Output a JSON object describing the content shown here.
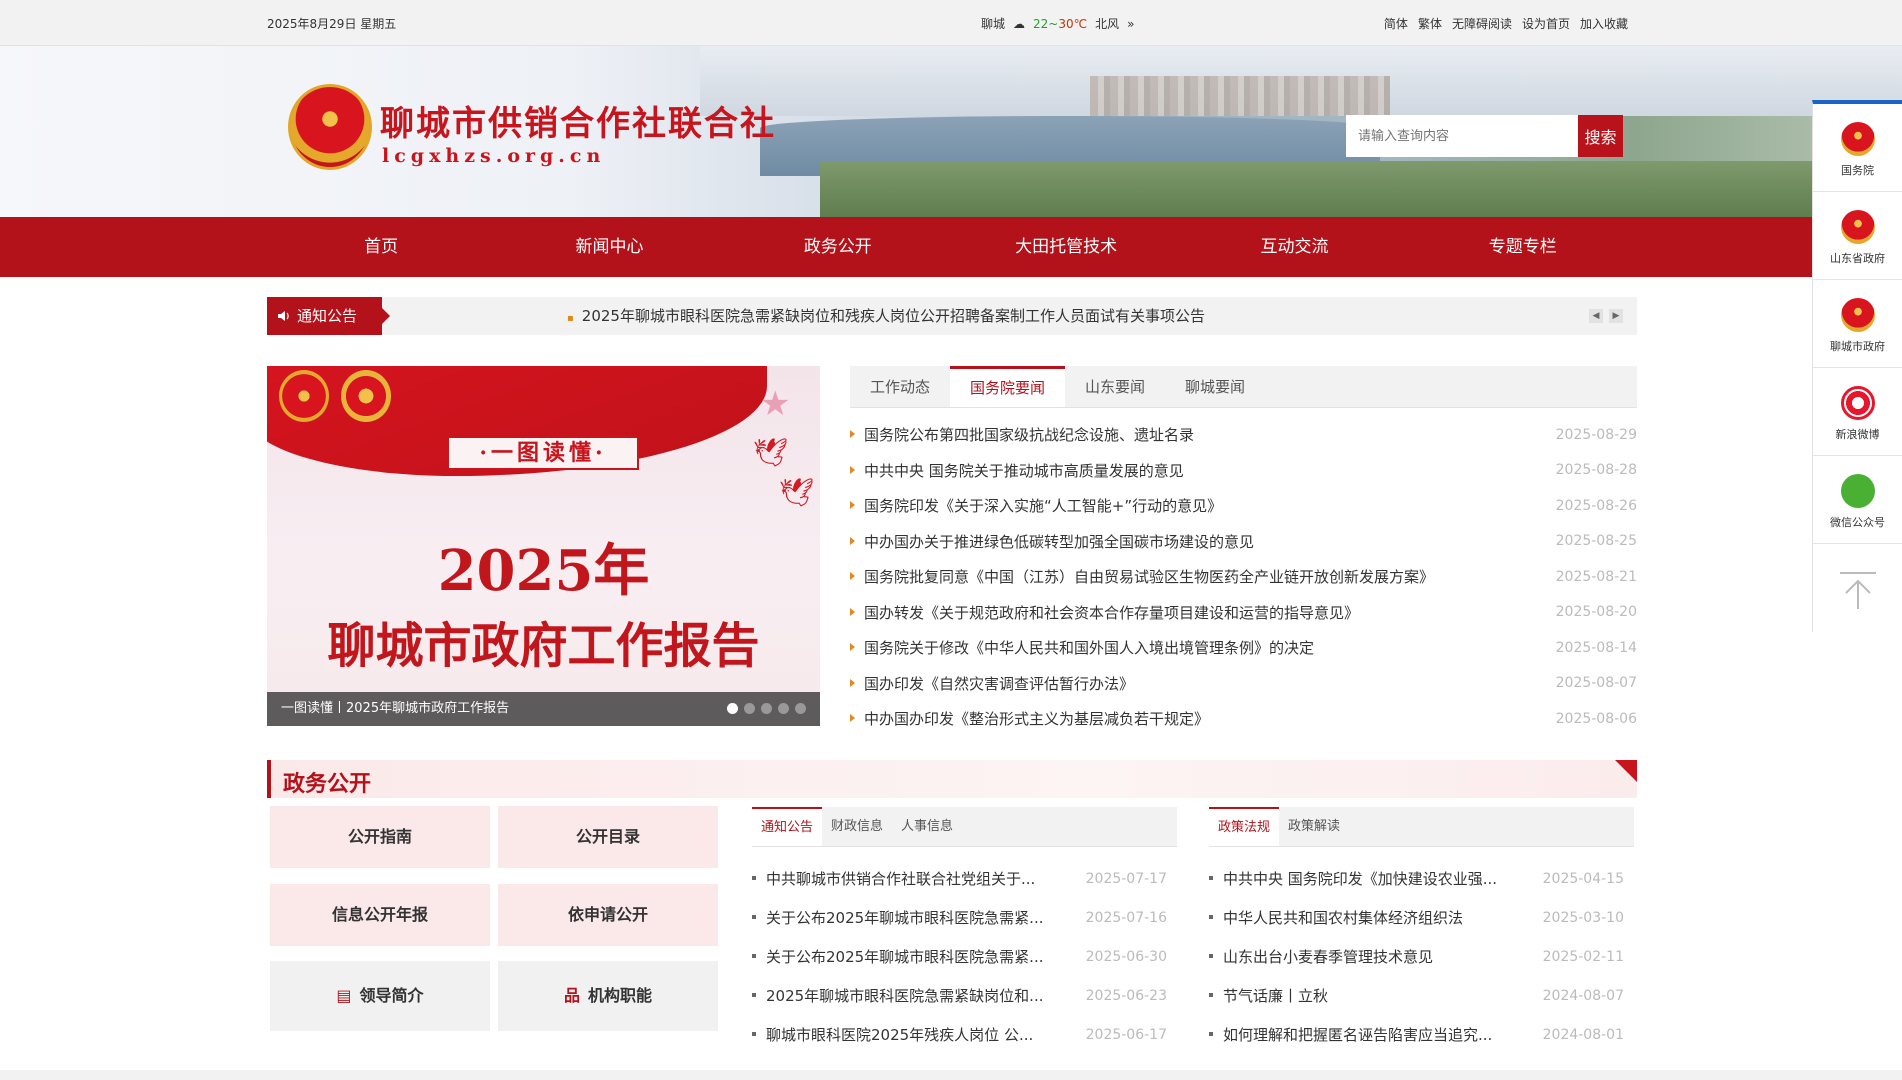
{
  "topbar": {
    "date": "2025年8月29日 星期五",
    "city": "聊城",
    "temp_low": "22",
    "temp_sep": "~",
    "temp_high": "30℃",
    "wind": "北风",
    "links": [
      "简体",
      "繁体",
      "无障碍阅读",
      "设为首页",
      "加入收藏"
    ]
  },
  "header": {
    "title": "聊城市供销合作社联合社",
    "domain": "lcgxhzs.org.cn",
    "search_placeholder": "请输入查询内容",
    "search_button": "搜索"
  },
  "nav": [
    "首页",
    "新闻中心",
    "政务公开",
    "大田托管技术",
    "互动交流",
    "专题专栏"
  ],
  "notice": {
    "label": "通知公告",
    "message": "2025年聊城市眼科医院急需紧缺岗位和残疾人岗位公开招聘备案制工作人员面试有关事项公告"
  },
  "slider": {
    "tag": "·一图读懂·",
    "year": "2025年",
    "title": "聊城市政府工作报告",
    "caption": "一图读懂丨2025年聊城市政府工作报告",
    "active_index": 0,
    "count": 5
  },
  "news": {
    "tabs": [
      "工作动态",
      "国务院要闻",
      "山东要闻",
      "聊城要闻"
    ],
    "active_tab": 1,
    "items": [
      {
        "title": "国务院公布第四批国家级抗战纪念设施、遗址名录",
        "date": "2025-08-29"
      },
      {
        "title": "中共中央 国务院关于推动城市高质量发展的意见",
        "date": "2025-08-28"
      },
      {
        "title": "国务院印发《关于深入实施“人工智能+”行动的意见》",
        "date": "2025-08-26"
      },
      {
        "title": "中办国办关于推进绿色低碳转型加强全国碳市场建设的意见",
        "date": "2025-08-25"
      },
      {
        "title": "国务院批复同意《中国（江苏）自由贸易试验区生物医药全产业链开放创新发展方案》",
        "date": "2025-08-21"
      },
      {
        "title": "国办转发《关于规范政府和社会资本合作存量项目建设和运营的指导意见》",
        "date": "2025-08-20"
      },
      {
        "title": "国务院关于修改《中华人民共和国外国人入境出境管理条例》的决定",
        "date": "2025-08-14"
      },
      {
        "title": "国办印发《自然灾害调查评估暂行办法》",
        "date": "2025-08-07"
      },
      {
        "title": "中办国办印发《整治形式主义为基层减负若干规定》",
        "date": "2025-08-06"
      }
    ]
  },
  "gov": {
    "heading": "政务公开",
    "buttons": [
      "公开指南",
      "公开目录",
      "信息公开年报",
      "依申请公开"
    ],
    "leader_button": "领导简介",
    "org_button": "机构职能",
    "box1": {
      "tabs": [
        "通知公告",
        "财政信息",
        "人事信息"
      ],
      "items": [
        {
          "title": "中共聊城市供销合作社联合社党组关于...",
          "date": "2025-07-17"
        },
        {
          "title": "关于公布2025年聊城市眼科医院急需紧...",
          "date": "2025-07-16"
        },
        {
          "title": "关于公布2025年聊城市眼科医院急需紧...",
          "date": "2025-06-30"
        },
        {
          "title": "2025年聊城市眼科医院急需紧缺岗位和...",
          "date": "2025-06-23"
        },
        {
          "title": "聊城市眼科医院2025年残疾人岗位 公...",
          "date": "2025-06-17"
        }
      ]
    },
    "box2": {
      "tabs": [
        "政策法规",
        "政策解读"
      ],
      "items": [
        {
          "title": "中共中央 国务院印发《加快建设农业强...",
          "date": "2025-04-15"
        },
        {
          "title": "中华人民共和国农村集体经济组织法",
          "date": "2025-03-10"
        },
        {
          "title": "山东出台小麦春季管理技术意见",
          "date": "2025-02-11"
        },
        {
          "title": "节气话廉丨立秋",
          "date": "2024-08-07"
        },
        {
          "title": "如何理解和把握匿名诬告陷害应当追究...",
          "date": "2024-08-01"
        }
      ]
    }
  },
  "sidebar": [
    "国务院",
    "山东省政府",
    "聊城市政府",
    "新浪微博",
    "微信公众号"
  ],
  "colors": {
    "brand_red": "#b3121a",
    "accent_orange": "#e08a1e",
    "sidebar_blue": "#1b64c8"
  }
}
